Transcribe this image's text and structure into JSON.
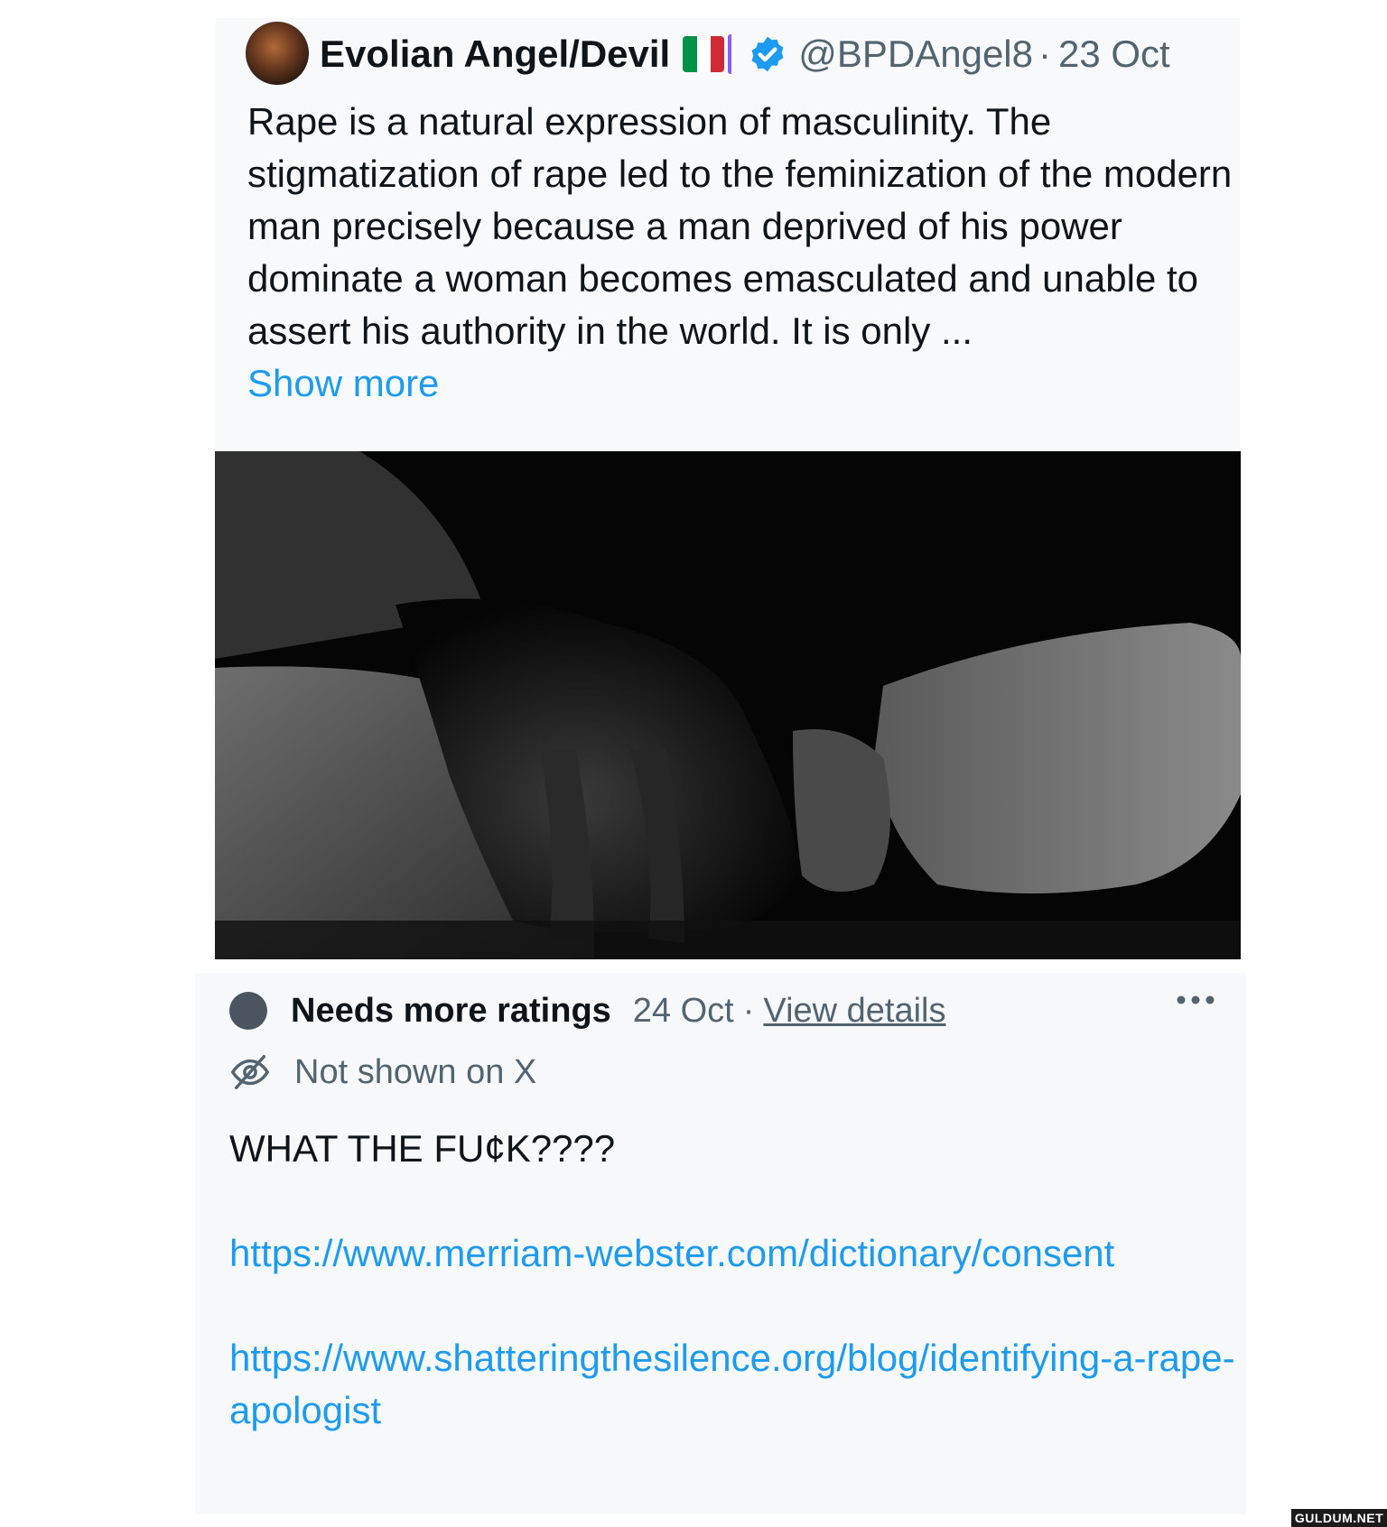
{
  "tweet": {
    "display_name": "Evolian Angel/Devil",
    "flag_colors": [
      "#009246",
      "#ffffff",
      "#ce2b37"
    ],
    "verified_color": "#1d9bf0",
    "handle": "@BPDAngel8",
    "separator": "·",
    "date": "23 Oct",
    "text": "Rape is a natural expression of masculinity. The stigmatization of rape led to the feminization of the modern man precisely because a man deprived of his power dominate a woman becomes emasculated and unable to assert his authority in the world. It is only ...",
    "show_more": "Show more",
    "image_icon": "clenched-hands-photo"
  },
  "community_note": {
    "status_dot_color": "#4a5560",
    "status_label": "Needs more ratings",
    "date": "24 Oct",
    "separator": "·",
    "view_details": "View details",
    "visibility": "Not shown on X",
    "body": "WHAT THE FU¢K????",
    "links": [
      "https://www.merriam-webster.com/dictionary/consent",
      "https://www.shatteringthesilence.org/blog/identifying-a-rape-apologist"
    ]
  },
  "watermark": "GULDUM.NET"
}
